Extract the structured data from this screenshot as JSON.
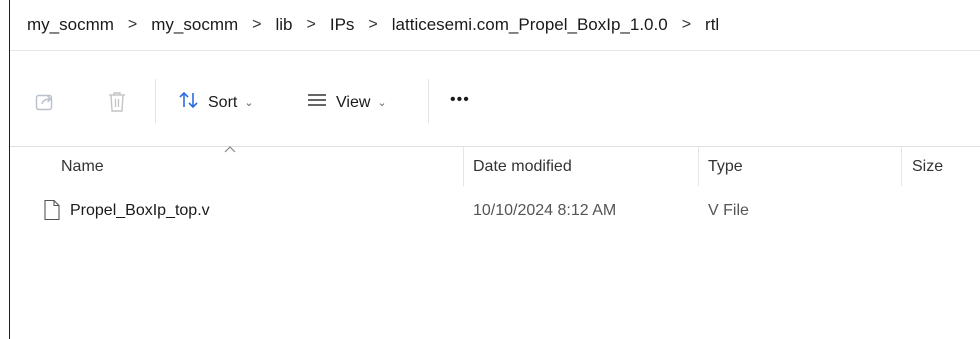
{
  "breadcrumb": [
    "my_socmm",
    "my_socmm",
    "lib",
    "IPs",
    "latticesemi.com_Propel_BoxIp_1.0.0",
    "rtl"
  ],
  "breadcrumb_separator": ">",
  "toolbar": {
    "share_icon": "share-icon",
    "delete_icon": "trash-icon",
    "sort_label": "Sort",
    "view_label": "View",
    "more_label": "•••"
  },
  "columns": {
    "name": "Name",
    "date_modified": "Date modified",
    "type": "Type",
    "size": "Size"
  },
  "files": [
    {
      "name": "Propel_BoxIp_top.v",
      "date_modified": "10/10/2024 8:12 AM",
      "type": "V File",
      "size": ""
    }
  ],
  "colors": {
    "accent": "#2d6cdf",
    "text": "#1a1a1a",
    "muted": "#555555"
  }
}
